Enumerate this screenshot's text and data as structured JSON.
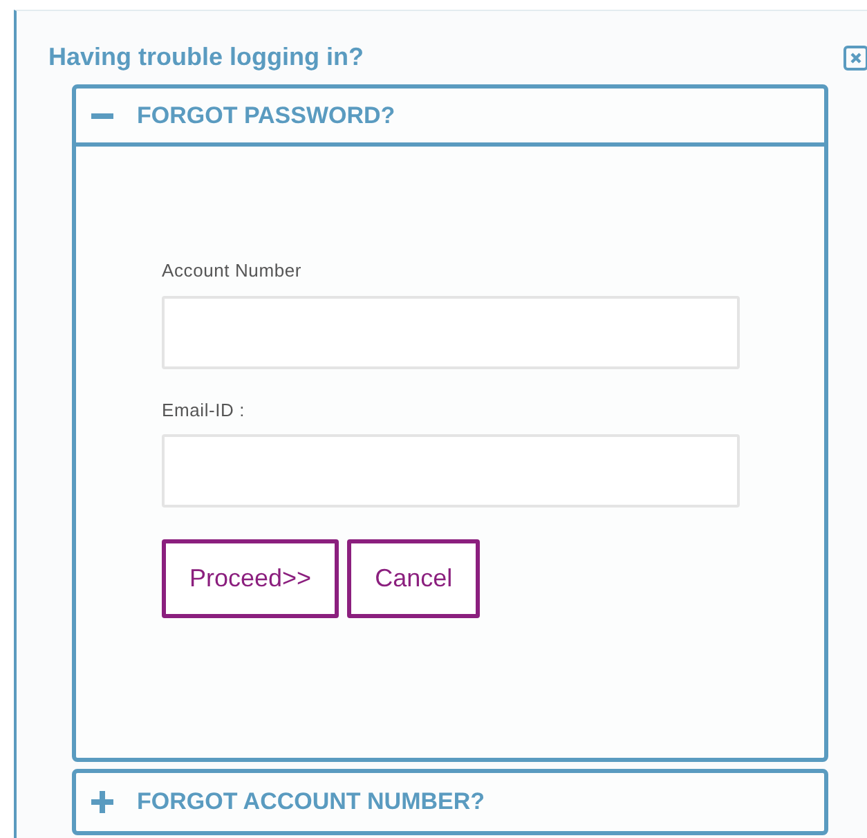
{
  "dialog": {
    "title": "Having trouble logging in?"
  },
  "sections": [
    {
      "title": "FORGOT PASSWORD?",
      "expanded": true,
      "fields": [
        {
          "label": "Account Number"
        },
        {
          "label": "Email-ID :"
        }
      ],
      "buttons": [
        "Proceed>>",
        "Cancel"
      ]
    },
    {
      "title": "FORGOT ACCOUNT NUMBER?",
      "expanded": false
    }
  ]
}
